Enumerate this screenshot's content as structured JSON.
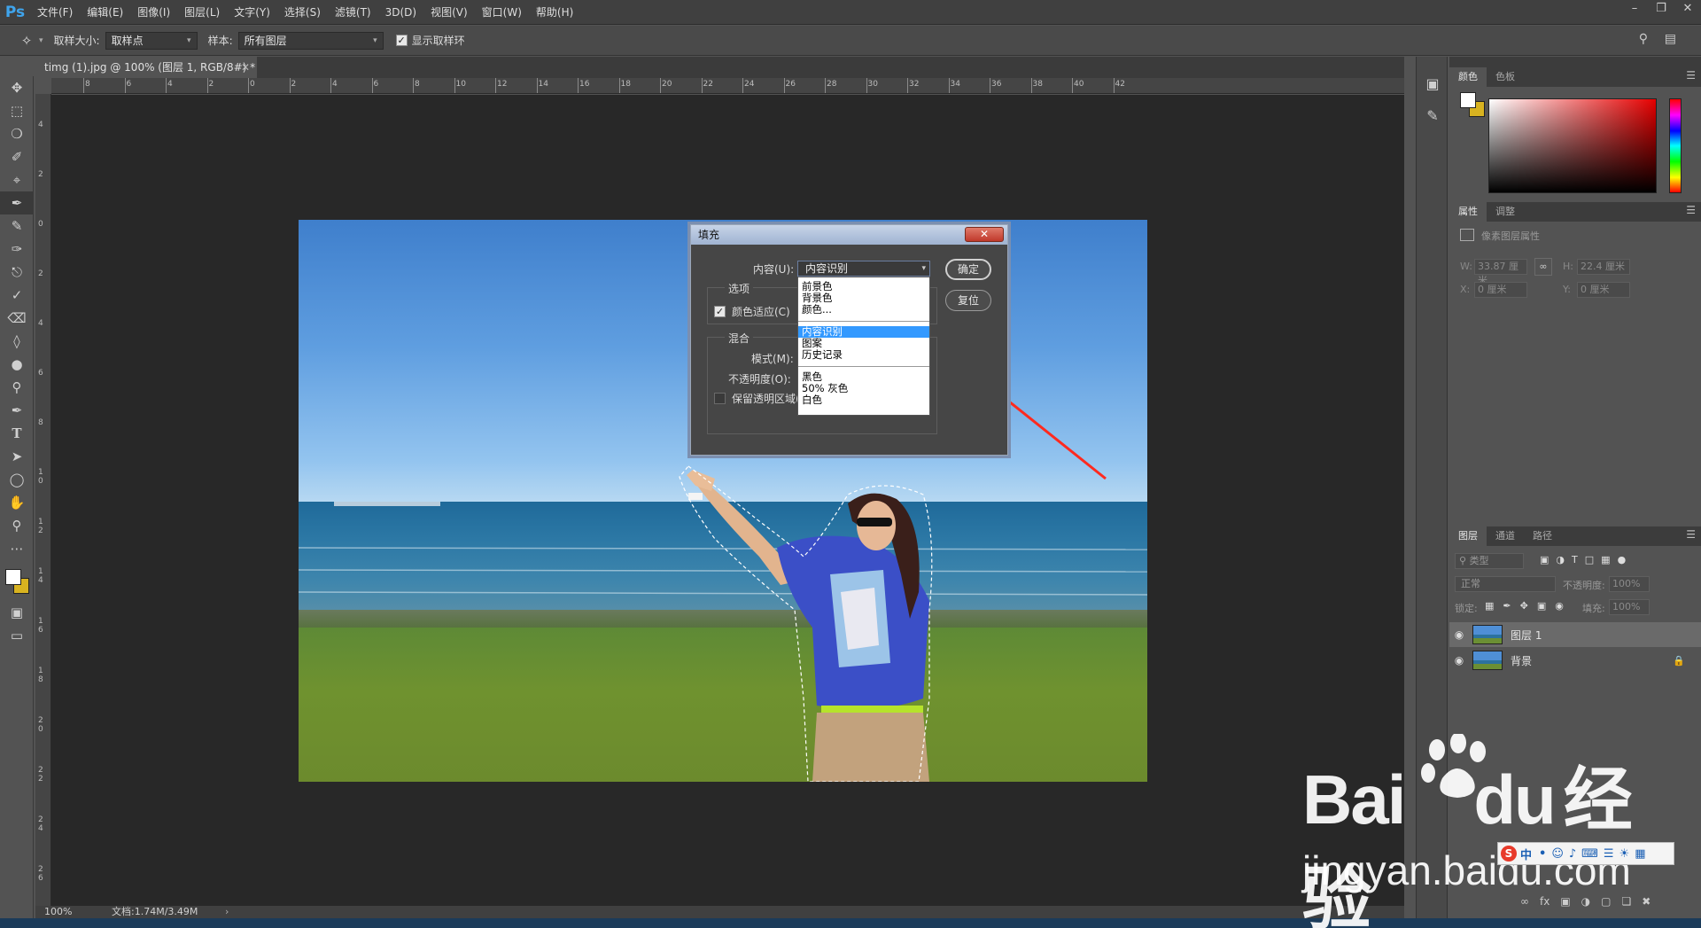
{
  "app": {
    "logo": "Ps"
  },
  "menu": [
    "文件(F)",
    "编辑(E)",
    "图像(I)",
    "图层(L)",
    "文字(Y)",
    "选择(S)",
    "滤镜(T)",
    "3D(D)",
    "视图(V)",
    "窗口(W)",
    "帮助(H)"
  ],
  "options": {
    "sample_size_label": "取样大小:",
    "sample_size_value": "取样点",
    "sample_label": "样本:",
    "sample_value": "所有图层",
    "show_ring_label": "显示取样环"
  },
  "document": {
    "tab_title": "timg (1).jpg @ 100% (图层 1, RGB/8#) *",
    "ruler_top": [
      "8",
      "6",
      "4",
      "2",
      "0",
      "2",
      "4",
      "6",
      "8",
      "10",
      "12",
      "14",
      "16",
      "18",
      "20",
      "22",
      "24",
      "26",
      "28",
      "30",
      "32",
      "34",
      "36",
      "38",
      "40",
      "42"
    ],
    "ruler_left": [
      "4",
      "2",
      "0",
      "2",
      "4",
      "6",
      "8",
      "1 0",
      "1 2",
      "1 4",
      "1 6",
      "1 8",
      "2 0",
      "2 2",
      "2 4",
      "2 6"
    ]
  },
  "fill_dialog": {
    "title": "填充",
    "content_label": "内容(U):",
    "content_value": "内容识别",
    "ok_label": "确定",
    "reset_label": "复位",
    "options_group": "选项",
    "color_adapt_label": "颜色适应(C)",
    "blend_group": "混合",
    "mode_label": "模式(M):",
    "opacity_label": "不透明度(O):",
    "preserve_label": "保留透明区域(P)",
    "dropdown_group1": [
      "前景色",
      "背景色",
      "颜色..."
    ],
    "dropdown_group2": [
      "内容识别",
      "图案",
      "历史记录"
    ],
    "dropdown_group3": [
      "黑色",
      "50% 灰色",
      "白色"
    ]
  },
  "color_panel": {
    "tabs": [
      "颜色",
      "色板"
    ],
    "fg_color": "#ffffff",
    "bg_color": "#d8b320"
  },
  "properties_panel": {
    "tabs": [
      "属性",
      "调整"
    ],
    "heading": "像素图层属性",
    "w_label": "W:",
    "w_value": "33.87 厘米",
    "h_label": "H:",
    "h_value": "22.4 厘米",
    "x_label": "X:",
    "x_value": "0 厘米",
    "y_label": "Y:",
    "y_value": "0 厘米"
  },
  "layers_panel": {
    "tabs": [
      "图层",
      "通道",
      "路径"
    ],
    "filter_placeholder": "类型",
    "blend_mode": "正常",
    "opacity_label": "不透明度:",
    "opacity_value": "100%",
    "lock_label": "锁定:",
    "fill_label": "填充:",
    "fill_value": "100%",
    "layers": [
      {
        "name": "图层 1",
        "active": true
      },
      {
        "name": "背景",
        "active": false
      }
    ]
  },
  "status": {
    "zoom": "100%",
    "doc_info": "文档:1.74M/3.49M"
  },
  "watermark": {
    "brand": "Bai",
    "brand2": "du",
    "brand_cn": "经验",
    "url": "jingyan.baidu.com",
    "ime": "中"
  }
}
